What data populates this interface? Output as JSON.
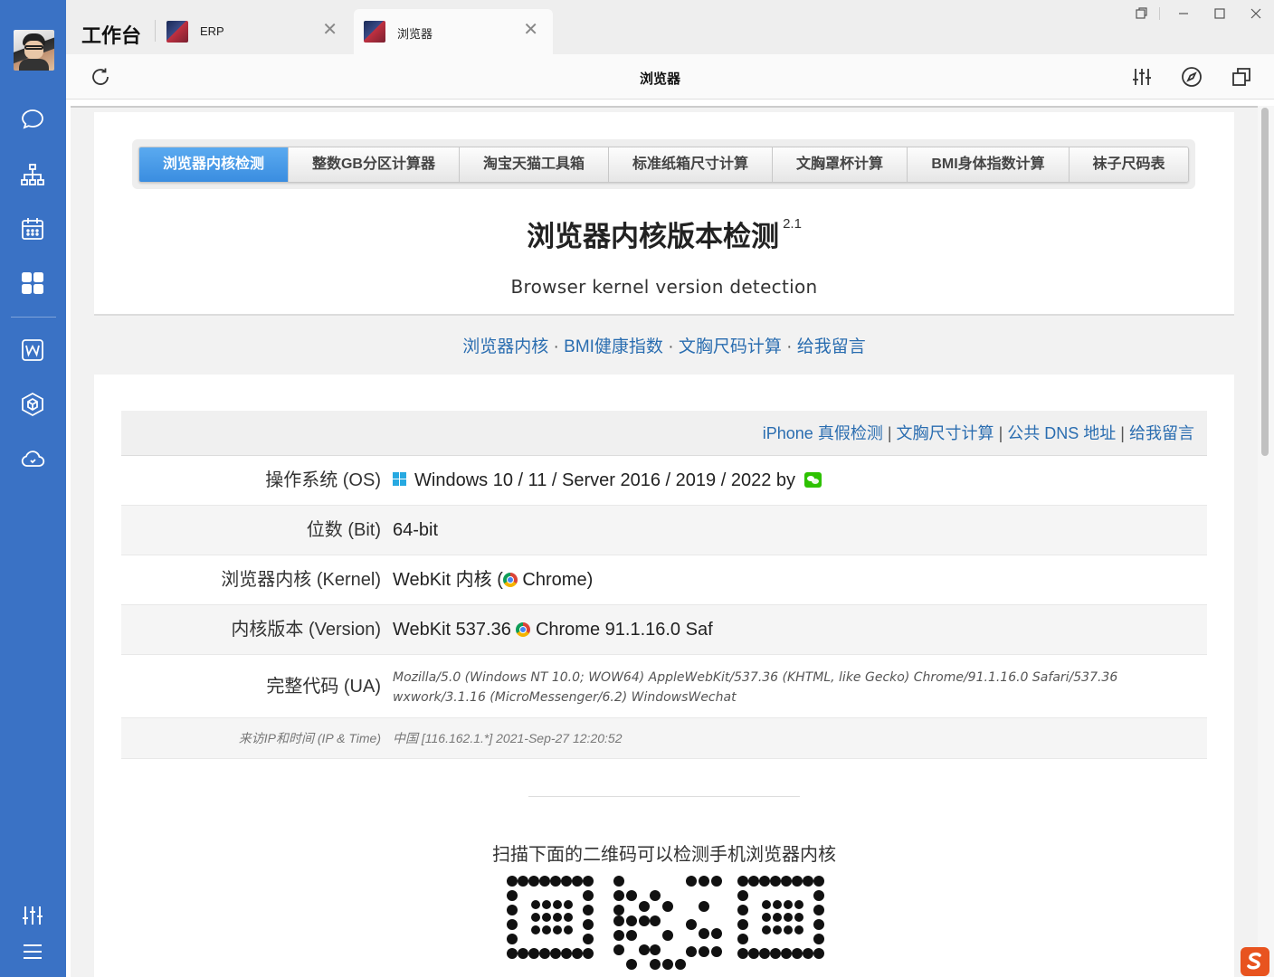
{
  "workspace_title": "工作台",
  "tabs": [
    {
      "label": "ERP"
    },
    {
      "label": "浏览器"
    }
  ],
  "toolbar": {
    "title": "浏览器"
  },
  "tool_tabs": [
    "浏览器内核检测",
    "整数GB分区计算器",
    "淘宝天猫工具箱",
    "标准纸箱尺寸计算",
    "文胸罩杯计算",
    "BMI身体指数计算",
    "袜子尺码表"
  ],
  "page": {
    "title": "浏览器内核版本检测",
    "version": "2.1",
    "subtitle": "Browser kernel version detection",
    "links": [
      "浏览器内核",
      "BMI健康指数",
      "文胸尺码计算",
      "给我留言"
    ],
    "links_sep": "·",
    "table_links": [
      "iPhone 真假检测",
      "文胸尺寸计算",
      "公共 DNS 地址",
      "给我留言"
    ],
    "table_links_sep": "|",
    "rows": {
      "os": {
        "key": "操作系统 (OS)",
        "value": "Windows 10 / 11 / Server 2016 / 2019 / 2022 by"
      },
      "bit": {
        "key": "位数 (Bit)",
        "value": "64-bit"
      },
      "kernel": {
        "key": "浏览器内核 (Kernel)",
        "value_pre": "WebKit 内核 (",
        "value_post": " Chrome)"
      },
      "version": {
        "key": "内核版本 (Version)",
        "value_pre": "WebKit 537.36 ",
        "value_post": " Chrome 91.1.16.0 Saf"
      },
      "ua": {
        "key": "完整代码 (UA)",
        "value": "Mozilla/5.0 (Windows NT 10.0; WOW64) AppleWebKit/537.36 (KHTML, like Gecko) Chrome/91.1.16.0 Safari/537.36 wxwork/3.1.16 (MicroMessenger/6.2) WindowsWechat"
      },
      "ip": {
        "key": "来访IP和时间 (IP & Time)",
        "value": "中国 [116.162.1.*]    2021-Sep-27 12:20:52"
      }
    },
    "qr_caption": "扫描下面的二维码可以检测手机浏览器内核"
  },
  "colors": {
    "sidebar": "#3a72c5",
    "link": "#2a6db0",
    "active_tab": "#3a8de0"
  }
}
